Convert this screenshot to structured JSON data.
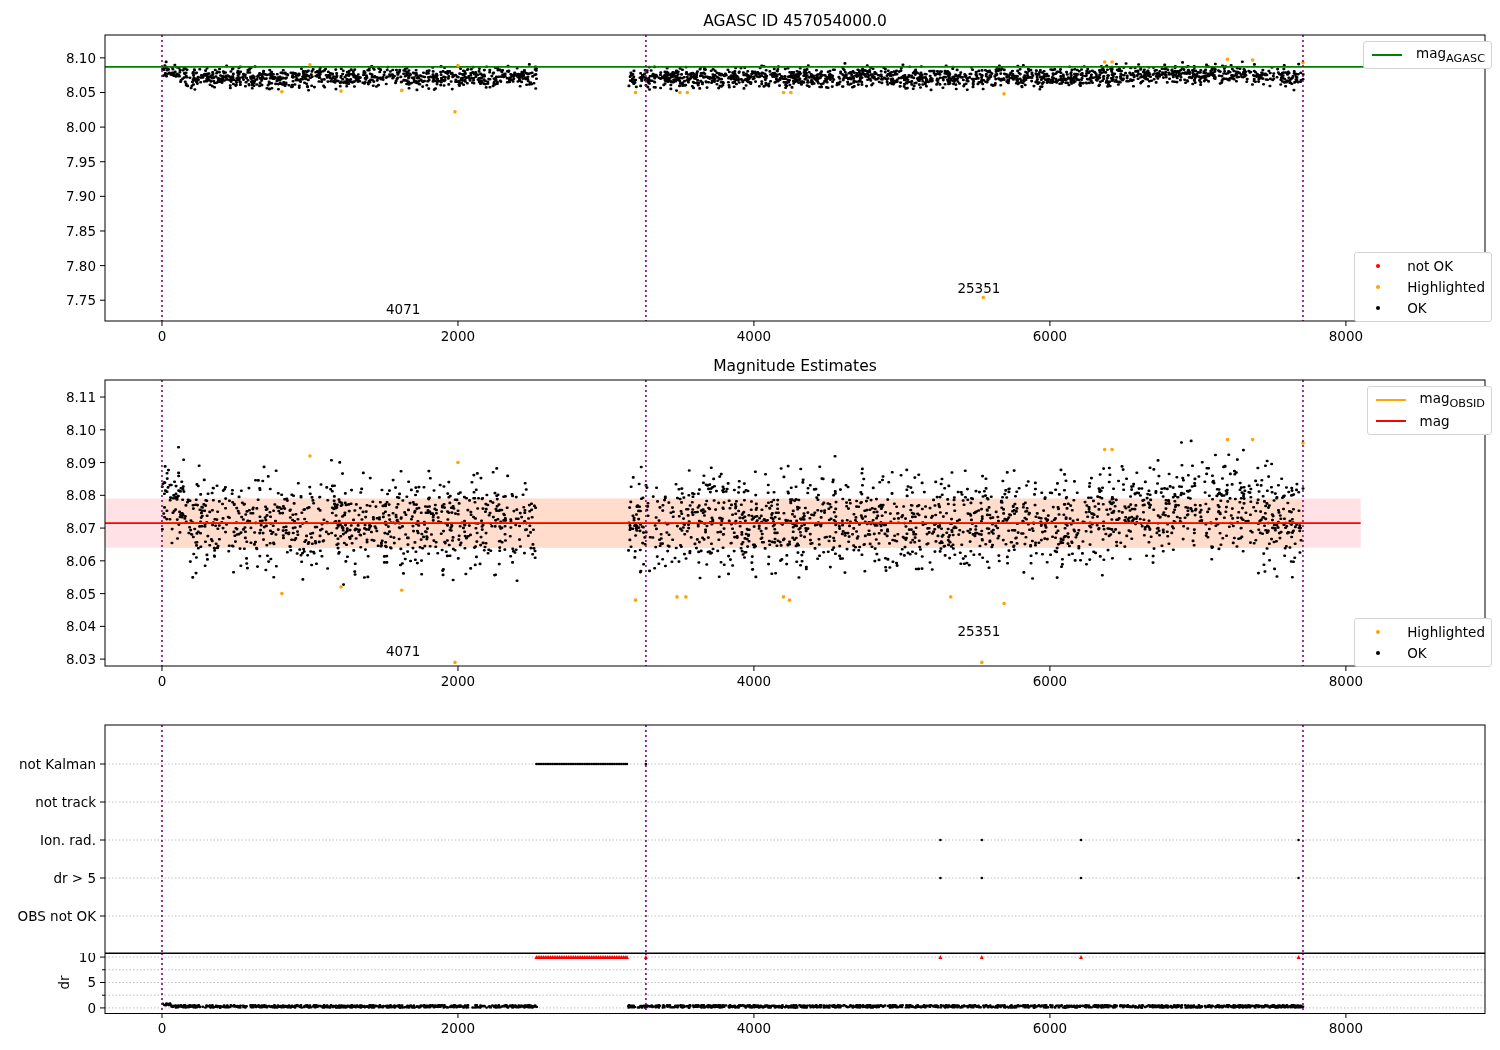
{
  "panels": [
    {
      "kind": "magnitude",
      "title": "AGASC ID 457054000.0",
      "x_tick_labels": [
        "0",
        "2000",
        "4000",
        "6000",
        "8000"
      ],
      "y_tick_labels": [
        "8.10",
        "8.05",
        "8.00",
        "7.95",
        "7.90",
        "7.85",
        "7.80",
        "7.75"
      ],
      "point_labels": [
        "4071",
        "25351"
      ],
      "legends": [
        {
          "items": [
            {
              "label": "mag$_{AGASC}$",
              "kind": "line",
              "color": "#008000"
            }
          ]
        },
        {
          "items": [
            {
              "label": "not OK",
              "kind": "dot",
              "color": "#ff0000"
            },
            {
              "label": "Highlighted",
              "kind": "dot",
              "color": "#ffa500"
            },
            {
              "label": "OK",
              "kind": "dot",
              "color": "#000000"
            }
          ]
        }
      ]
    },
    {
      "kind": "estimates",
      "title": "Magnitude Estimates",
      "x_tick_labels": [
        "0",
        "2000",
        "4000",
        "6000",
        "8000"
      ],
      "y_tick_labels": [
        "8.11",
        "8.10",
        "8.09",
        "8.08",
        "8.07",
        "8.06",
        "8.05",
        "8.04",
        "8.03"
      ],
      "point_labels": [
        "4071",
        "25351"
      ],
      "legends": [
        {
          "items": [
            {
              "label": "mag$_{OBSID}$",
              "kind": "line",
              "color": "#ffa500"
            },
            {
              "label": "mag",
              "kind": "line",
              "color": "#ff0000"
            }
          ]
        },
        {
          "items": [
            {
              "label": "Highlighted",
              "kind": "dot",
              "color": "#ffa500"
            },
            {
              "label": "OK",
              "kind": "dot",
              "color": "#000000"
            }
          ]
        }
      ]
    },
    {
      "kind": "flags",
      "y_tick_labels": [
        "not Kalman",
        "not track",
        "Ion. rad.",
        "dr > 5",
        "OBS not OK"
      ]
    },
    {
      "kind": "dr",
      "y_label": "dr",
      "x_tick_labels": [
        "0",
        "2000",
        "4000",
        "6000",
        "8000"
      ],
      "y_tick_labels": [
        "10",
        "5",
        "0"
      ]
    }
  ]
}
